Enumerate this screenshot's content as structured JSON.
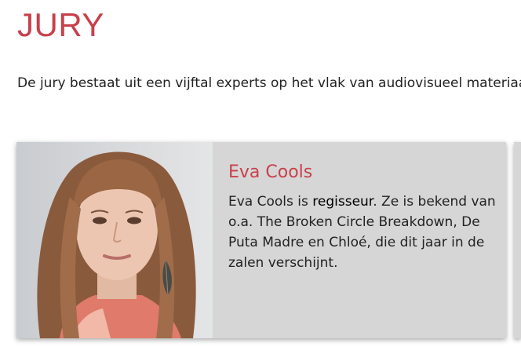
{
  "page": {
    "title": "JURY",
    "intro": "De jury bestaat uit een vijftal experts op het vlak van audiovisueel materiaal"
  },
  "jury": {
    "members": [
      {
        "name": "Eva Cools",
        "bio_before": "Eva Cools is ",
        "bio_role": "regisseur",
        "bio_after": ". Ze is bekend van o.a. The Broken Circle Breakdown, De Puta Madre en Chloé, die dit jaar in de zalen verschijnt."
      }
    ]
  },
  "colors": {
    "accent": "#c8404b",
    "card_background": "#d6d6d6",
    "text": "#222222"
  }
}
